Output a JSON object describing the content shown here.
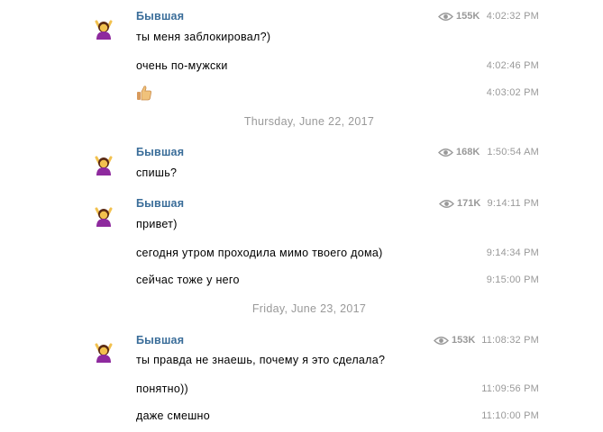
{
  "messages": [
    {
      "sender": "Бывшая",
      "views": "155K",
      "time": "4:02:32 PM",
      "text": "ты меня заблокировал?)"
    },
    {
      "time": "4:02:46 PM",
      "text": "очень по-мужски"
    },
    {
      "time": "4:03:02 PM",
      "emoji": "thumbs-up"
    },
    {
      "date": "Thursday, June 22, 2017"
    },
    {
      "sender": "Бывшая",
      "views": "168K",
      "time": "1:50:54 AM",
      "text": "спишь?"
    },
    {
      "sender": "Бывшая",
      "views": "171K",
      "time": "9:14:11 PM",
      "text": "привет)"
    },
    {
      "time": "9:14:34 PM",
      "text": "сегодня утром проходила мимо твоего дома)"
    },
    {
      "time": "9:15:00 PM",
      "text": "сейчас тоже у него"
    },
    {
      "date": "Friday, June 23, 2017"
    },
    {
      "sender": "Бывшая",
      "views": "153K",
      "time": "11:08:32 PM",
      "text": "ты правда не знаешь, почему я это сделала?"
    },
    {
      "time": "11:09:56 PM",
      "text": "понятно))"
    },
    {
      "time": "11:10:00 PM",
      "text": "даже смешно"
    }
  ],
  "colors": {
    "sender": "#3a6d99",
    "meta": "#999999",
    "text": "#000000"
  },
  "icons": {
    "views": "eye-icon",
    "avatar": "woman-gesturing-emoji",
    "reaction": "thumbs-up-emoji"
  }
}
